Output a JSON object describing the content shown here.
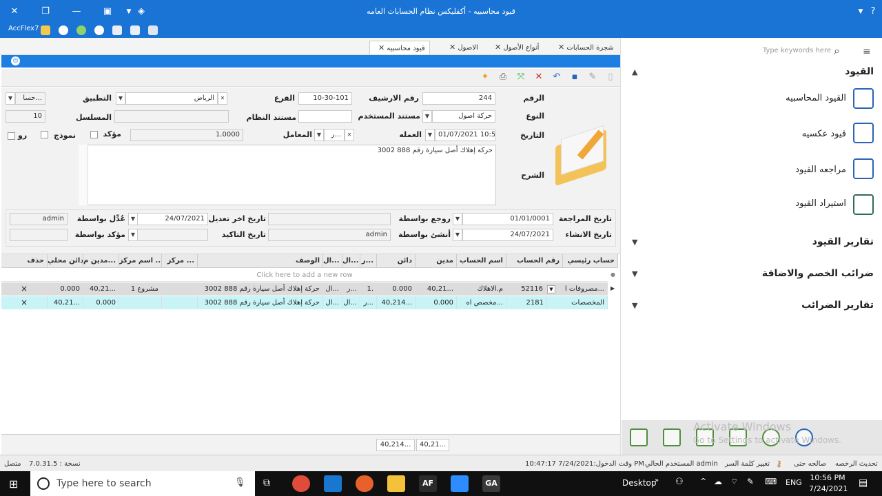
{
  "window": {
    "title": "قيود محاسبيه - أكفليكس نظام الحسابات العامه",
    "app_name": "AccFlex7"
  },
  "tabs": [
    {
      "label": "شجرة الحسابات"
    },
    {
      "label": "أنواع الأصول"
    },
    {
      "label": "الاصول"
    },
    {
      "label": "قيود محاسبيه"
    }
  ],
  "form": {
    "number_label": "الرقم",
    "number_value": "244",
    "archive_label": "رقم الارشيف",
    "branch_label": "الفرع",
    "branch_value": "10-30-101",
    "app_label": "التطبيق",
    "app_value": "الرياض",
    "app2_value": "حسا...",
    "type_label": "النوع",
    "type_value": "حركة اصول",
    "user_doc_label": "مستند المستخدم",
    "system_doc_label": "مستند النظام",
    "serial_label": "المسلسل",
    "serial_value": "10",
    "date_label": "التاريخ",
    "date_value": "01/07/2021 10:55",
    "currency_label": "العمله",
    "currency_value": "ر...",
    "factor_label": "المعامل",
    "factor_value": "1.0000",
    "confirmed_label": "مؤكد",
    "template_label": "نموذج",
    "rw_label": "رو",
    "description_label": "الشرح",
    "description_value": "حركة إهلاك أصل سيارة رقم 888 3002",
    "review_date_label": "تاريخ المراجعة",
    "review_date_value": "01/01/0001",
    "reviewed_by_label": "روجع بواسطة",
    "last_modified_label": "تاريخ اخر تعديل",
    "last_modified_value": "24/07/2021",
    "modified_by_label": "عُدِّل بواسطة",
    "modified_by_value": "admin",
    "created_date_label": "تاريخ الانشاء",
    "created_date_value": "24/07/2021",
    "created_by_label": "أنشئ بواسطة",
    "created_by_value": "admin",
    "confirm_date_label": "تاريخ التاكيد",
    "confirmed_by_label": "مؤكد بواسطة"
  },
  "grid": {
    "headers": [
      "حساب رئيسي",
      "رقم الحساب",
      "اسم الحساب",
      "مدين",
      "دائن",
      "ر...",
      "ال...",
      "ال...",
      "الوصف",
      "مركز ...",
      "اسم مركز ...",
      "مدين م...",
      "دائن محلي",
      "حذف"
    ],
    "add_row_hint": "Click here to add a new row",
    "rows": [
      [
        "مصروفات ا...",
        "52116",
        "م.الاهلاك",
        "40,21...",
        "0.000",
        "1.",
        "ر...",
        "ال...",
        "حركة إهلاك أصل سيارة رقم 888 3002",
        "",
        "مشروع 1",
        "40,21...",
        "0.000",
        "×"
      ],
      [
        "المخصصات",
        "2181",
        "مخصص اه...",
        "0.000",
        "40,214...",
        "ر...",
        "ال...",
        "ال...",
        "حركة إهلاك أصل سيارة رقم 888 3002",
        "",
        "",
        "0.000",
        "40,21...",
        "×"
      ]
    ],
    "total_debit": "40,21...",
    "total_credit": "40,214..."
  },
  "side": {
    "search_placeholder": "Type keywords here",
    "section_entries": "القيود",
    "items": [
      {
        "label": "القيود المحاسبيه"
      },
      {
        "label": "قيود عكسيه"
      },
      {
        "label": "مراجعه القيود"
      },
      {
        "label": "استيراد القيود"
      }
    ],
    "section_reports": "تقارير القيود",
    "section_taxes": "ضرائب الخصم والاضافة",
    "section_tax_reports": "تقارير الضرائب",
    "watermark_1": "Activate Windows",
    "watermark_2": "Go to Settings to activate Windows."
  },
  "status": {
    "version": "نسخة : 7.0.31.5",
    "connected": "متصل",
    "license_update": "تحديث الرخصه",
    "greeting": "صالحه حتى",
    "change_password": "تغيير كلمة السر",
    "current_user": "المستخدم الحالي admin",
    "login_time": "وقت الدخول:7/24/2021 10:47:17 PM"
  },
  "taskbar": {
    "search_placeholder": "Type here to search",
    "desktop": "Desktop",
    "lang": "ENG",
    "time": "10:56 PM",
    "date": "7/24/2021"
  },
  "colors": {
    "accent": "#1a74d6",
    "selected_row": "#c9f4f7",
    "icon_blue": "#2a62b8"
  }
}
